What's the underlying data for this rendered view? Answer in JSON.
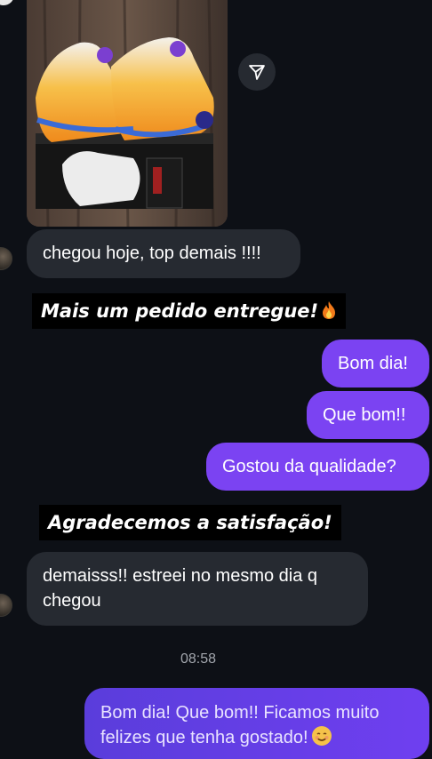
{
  "messages": {
    "incoming_1": "chegou hoje, top demais !!!!",
    "sticker_1": "Mais um pedido entregue!",
    "outgoing_1": "Bom dia!",
    "outgoing_2": "Que bom!!",
    "outgoing_3": "Gostou da qualidade?",
    "sticker_2": "Agradecemos a satisfação!",
    "incoming_2_line1": "demaisss!! estreei no mesmo dia q",
    "incoming_2_line2": "chegou",
    "timestamp": "08:58",
    "outgoing_4_line1": "Bom dia! Que bom!! Ficamos muito",
    "outgoing_4_line2": "felizes que tenha gostado!"
  },
  "icons": {
    "share": "paper-plane-icon",
    "sticker_emoji": "fire-emoji",
    "reply_emoji": "smiling-face-emoji"
  },
  "colors": {
    "background": "#0d1016",
    "incoming_bubble": "#262a31",
    "outgoing_bubble": "#7b43f2",
    "sticker_bg": "#000000",
    "timestamp": "#a2a6ad"
  }
}
